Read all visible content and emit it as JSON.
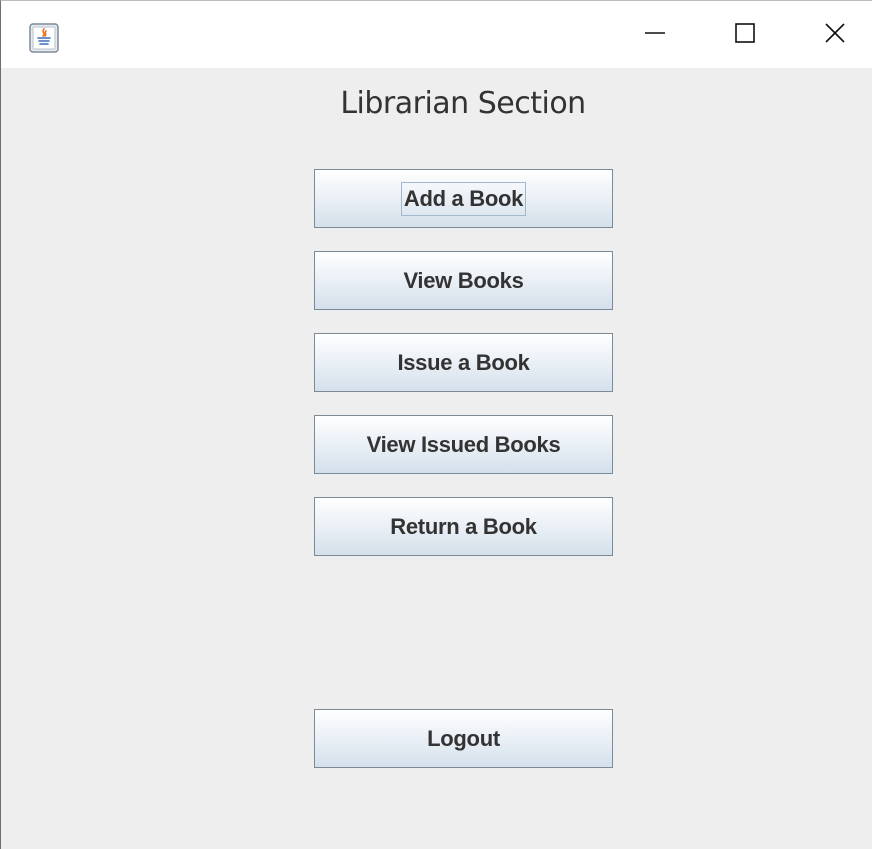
{
  "window": {
    "icon": "java-app-icon",
    "controls": {
      "minimize": "minimize-icon",
      "maximize": "maximize-icon",
      "close": "close-icon"
    }
  },
  "main": {
    "title": "Librarian Section",
    "buttons": {
      "add_book": "Add a Book",
      "view_books": "View Books",
      "issue_book": "Issue a Book",
      "view_issued": "View Issued Books",
      "return_book": "Return a Book",
      "logout": "Logout"
    }
  },
  "colors": {
    "background": "#eeeeee",
    "button_border": "#7a8a99",
    "text": "#333333"
  }
}
